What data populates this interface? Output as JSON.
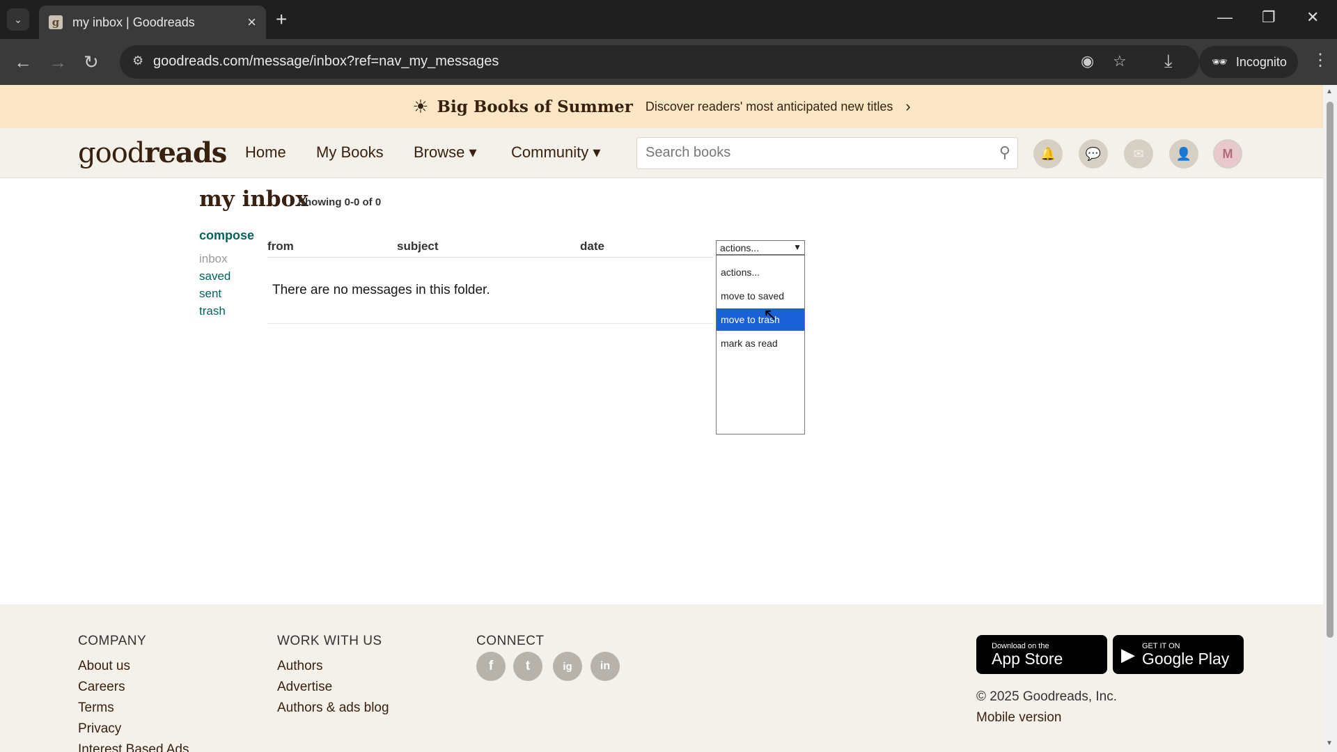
{
  "browser": {
    "tab_title": "my inbox | Goodreads",
    "favicon_letter": "g",
    "url": "goodreads.com/message/inbox?ref=nav_my_messages",
    "incognito_label": "Incognito"
  },
  "banner": {
    "title": "Big Books of Summer",
    "text": "Discover readers' most anticipated new titles"
  },
  "header": {
    "logo_light": "good",
    "logo_bold": "reads",
    "nav": {
      "home": "Home",
      "my_books": "My Books",
      "browse": "Browse ▾",
      "community": "Community ▾"
    },
    "search_placeholder": "Search books",
    "avatar_letter": "M"
  },
  "inbox": {
    "title": "my inbox",
    "showing": "Showing 0-0 of 0",
    "compose": "compose",
    "folders": [
      "inbox",
      "saved",
      "sent",
      "trash"
    ],
    "columns": [
      "from",
      "subject",
      "date"
    ],
    "empty_message": "There are no messages in this folder.",
    "actions_selected": "actions...",
    "actions_options": [
      "actions...",
      "move to saved",
      "move to trash",
      "mark as read"
    ],
    "highlighted_option_index": 2
  },
  "footer": {
    "company_heading": "COMPANY",
    "company_links": [
      "About us",
      "Careers",
      "Terms",
      "Privacy",
      "Interest Based Ads"
    ],
    "work_heading": "WORK WITH US",
    "work_links": [
      "Authors",
      "Advertise",
      "Authors & ads blog"
    ],
    "connect_heading": "CONNECT",
    "social": [
      "f",
      "t",
      "ig",
      "in"
    ],
    "app_store_small": "Download on the",
    "app_store_big": "App Store",
    "google_small": "GET IT ON",
    "google_big": "Google Play",
    "copyright": "© 2025 Goodreads, Inc.",
    "mobile": "Mobile version"
  }
}
